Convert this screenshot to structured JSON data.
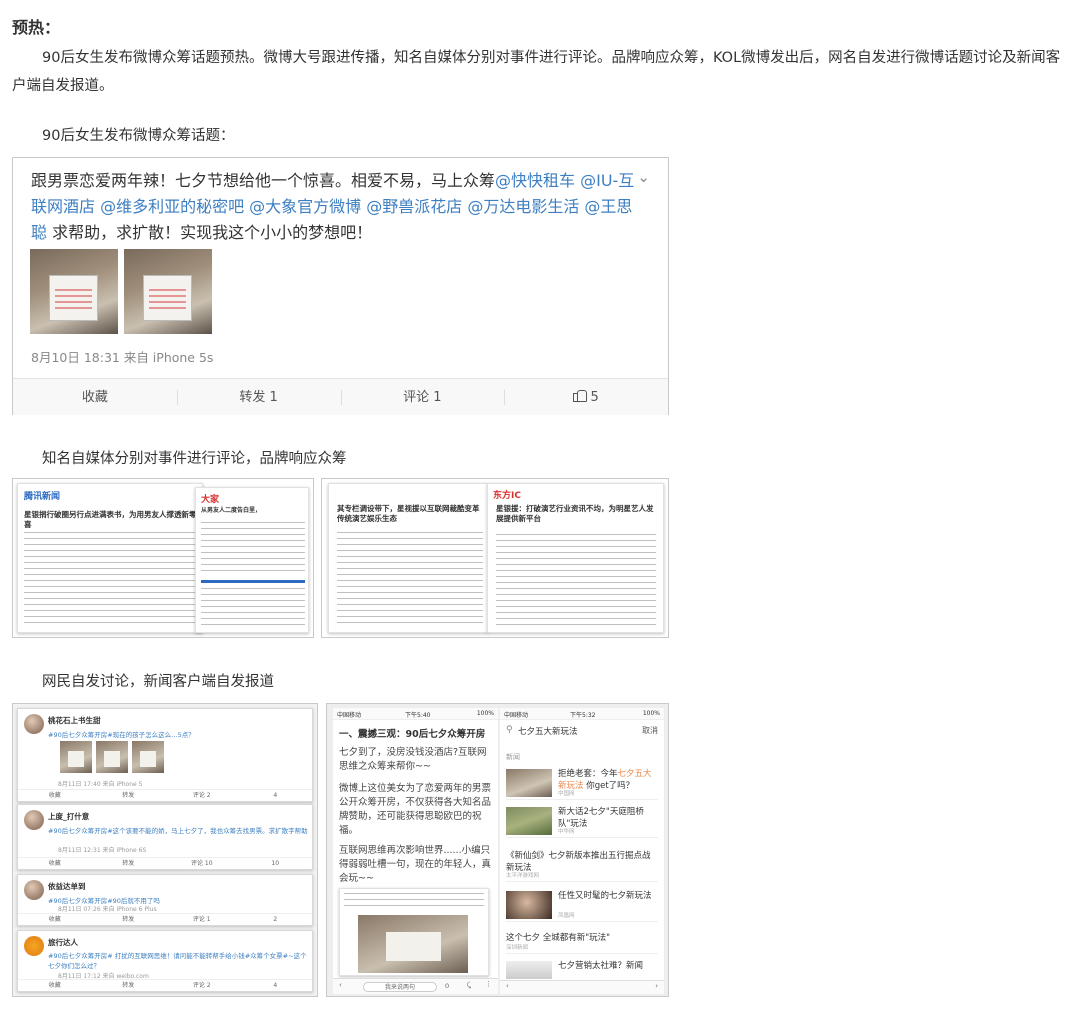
{
  "heading": "预热：",
  "intro": "90后女生发布微博众筹话题预热。微博大号跟进传播，知名自媒体分别对事件进行评论。品牌响应众筹，KOL微博发出后，网名自发进行微博话题讨论及新闻客户端自发报道。",
  "captions": {
    "weibo": "90后女生发布微博众筹话题：",
    "media": "知名自媒体分别对事件进行评论，品牌响应众筹",
    "netizens": "网民自发讨论，新闻客户端自发报道"
  },
  "weibo_post": {
    "text_before": "跟男票恋爱两年辣！七夕节想给他一个惊喜。相爱不易，马上众筹",
    "mentions": "@快快租车 @IU-互联网酒店 @维多利亚的秘密吧 @大象官方微博 @野兽派花店 @万达电影生活 @王思聪",
    "text_after": " 求帮助，求扩散！实现我这个小小的梦想吧！",
    "meta": "8月10日 18:31 来自 iPhone 5s",
    "actions": {
      "collect": "收藏",
      "repost": "转发 1",
      "comment": "评论 1",
      "like": "5"
    }
  },
  "media_shots": {
    "left": {
      "logo1": "腾讯新闻",
      "logo2": "大家",
      "title": "星银捐行破圈另行点进满表书，为用男友人撑透新零喜",
      "title2": "从男友人二度告白里，"
    },
    "right": {
      "title1": "其专栏调设带下，星视援以互联网裁酷变革传统演艺娱乐生态",
      "logo": "东方IC",
      "title2": "星银援：打破演艺行业资讯不均，为明星艺人发展提供新平台"
    }
  },
  "feed_cards": [
    {
      "name": "桃花石上书生甜",
      "text": "#90后七夕众筹开房#现在的孩子怎么这么…5点？",
      "time": "8月11日 17:40 来自 iPhone 5",
      "acts": [
        "收藏",
        "转发",
        "评论 2",
        "4"
      ]
    },
    {
      "name": "上度_打什意",
      "text": "#90后七夕众筹开房#这个该要不能的娇，马上七夕了，我也众筹去找男票。求扩散字帮助",
      "time": "8月11日 12:31 来自 iPhone 6S",
      "acts": [
        "收藏",
        "转发",
        "评论 10",
        "10"
      ]
    },
    {
      "name": "依益达单到",
      "text": "#90后七夕众筹开房#90后就不用了吗",
      "time": "8月11日 07:26 来自 iPhone 6 Plus",
      "acts": [
        "收藏",
        "转发",
        "评论 1",
        "2"
      ]
    },
    {
      "name": "旅行达人",
      "text": "#90后七夕众筹开房# 打扰的互联网思维！请问能不能转帮手给小钱#众筹个女票#~这个七夕你们怎么过？",
      "time": "8月11日 17:12 来自 weibo.com",
      "acts": [
        "收藏",
        "转发",
        "评论 2",
        "4"
      ]
    }
  ],
  "phone_left": {
    "status_carrier": "中国移动",
    "status_time": "下午5:40",
    "status_battery": "100%",
    "headline": "一、震撼三观：90后七夕众筹开房",
    "para1": "七夕到了，没房没钱没酒店?互联网思维之众筹来帮你~~",
    "para2": "微博上这位美女为了恋爱两年的男票公开众筹开房，不仅获得各大知名品牌赞助，还可能获得思聪欧巴的祝福。",
    "para3": "互联网思维再次影响世界......小编只得弱弱吐槽一句，现在的年轻人，真会玩~~",
    "bottom_input": "我来说两句",
    "bottom_count": "0"
  },
  "phone_right": {
    "status_carrier": "中国移动",
    "status_time": "下午5:32",
    "status_battery": "100%",
    "search": "七夕五大新玩法",
    "cancel": "取消",
    "section": "新闻",
    "items": [
      {
        "title_a": "拒绝老套：今年",
        "title_hl": "七夕五大新玩法",
        "title_b": " 你get了吗？",
        "sub": "中国网"
      },
      {
        "title_a": "新大话2七夕\"天庭阻桥队\"玩法",
        "title_hl": "",
        "title_b": "",
        "sub": "中华网"
      },
      {
        "title_a": "《新仙剑》七夕新版本推出五行掘点战新玩法",
        "title_hl": "",
        "title_b": "",
        "sub": "太平洋游戏网"
      },
      {
        "title_a": "任性又时髦的七夕新玩法",
        "title_hl": "",
        "title_b": "",
        "sub": "凤凰网"
      },
      {
        "title_a": "这个七夕 全城都有新\"玩法\"",
        "title_hl": "",
        "title_b": "",
        "sub": "深圳新闻"
      },
      {
        "title_a": "七夕营销太社难？新闻",
        "title_hl": "",
        "title_b": "",
        "sub": ""
      }
    ]
  }
}
